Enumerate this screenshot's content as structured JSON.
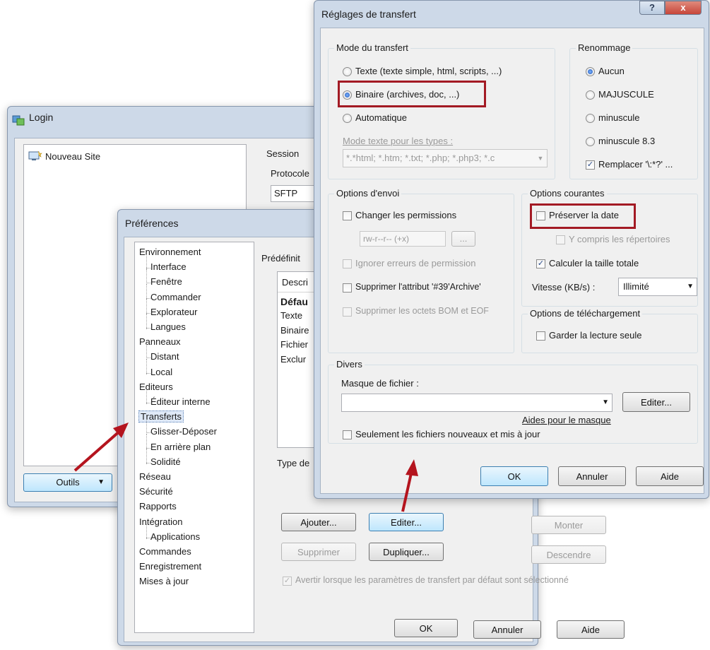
{
  "login": {
    "title": "Login",
    "site_item": "Nouveau Site",
    "session_label": "Session",
    "protocol_label": "Protocole",
    "protocol_value": "SFTP",
    "tools_button": "Outils"
  },
  "preferences": {
    "title": "Préférences",
    "tree": [
      {
        "label": "Environnement",
        "level": 0
      },
      {
        "label": "Interface",
        "level": 1
      },
      {
        "label": "Fenêtre",
        "level": 1
      },
      {
        "label": "Commander",
        "level": 1
      },
      {
        "label": "Explorateur",
        "level": 1
      },
      {
        "label": "Langues",
        "level": 1
      },
      {
        "label": "Panneaux",
        "level": 0
      },
      {
        "label": "Distant",
        "level": 1
      },
      {
        "label": "Local",
        "level": 1
      },
      {
        "label": "Editeurs",
        "level": 0
      },
      {
        "label": "Éditeur interne",
        "level": 1
      },
      {
        "label": "Transferts",
        "level": 0,
        "selected": true
      },
      {
        "label": "Glisser-Déposer",
        "level": 1
      },
      {
        "label": "En arrière plan",
        "level": 1
      },
      {
        "label": "Solidité",
        "level": 1
      },
      {
        "label": "Réseau",
        "level": 0
      },
      {
        "label": "Sécurité",
        "level": 0
      },
      {
        "label": "Rapports",
        "level": 0
      },
      {
        "label": "Intégration",
        "level": 0
      },
      {
        "label": "Applications",
        "level": 1
      },
      {
        "label": "Commandes",
        "level": 0
      },
      {
        "label": "Enregistrement",
        "level": 0
      },
      {
        "label": "Mises à jour",
        "level": 0
      }
    ],
    "presets_label": "Prédéfinit",
    "list_header": "Descri",
    "list_items": [
      "Défau",
      "Texte",
      "Binaire",
      "Fichier",
      "Exclur"
    ],
    "type_label": "Type de",
    "btn_add": "Ajouter...",
    "btn_edit": "Editer...",
    "btn_up": "Monter",
    "btn_delete": "Supprimer",
    "btn_duplicate": "Dupliquer...",
    "btn_down": "Descendre",
    "warn_checkbox": "Avertir lorsque les paramètres de transfert par défaut sont sélectionné",
    "btn_ok": "OK",
    "btn_cancel": "Annuler",
    "btn_help": "Aide"
  },
  "transfer": {
    "title": "Réglages de transfert",
    "help_glyph": "?",
    "close_glyph": "x",
    "mode_group": "Mode du transfert",
    "mode_text": "Texte (texte simple, html, scripts, ...)",
    "mode_binary": "Binaire (archives, doc, ...)",
    "mode_auto": "Automatique",
    "text_types_label": "Mode texte pour les types :",
    "text_types_value": "*.*html; *.htm; *.txt; *.php; *.php3; *.c",
    "rename_group": "Renommage",
    "rename_none": "Aucun",
    "rename_upper": "MAJUSCULE",
    "rename_lower": "minuscule",
    "rename_83": "minuscule 8.3",
    "rename_replace": "Remplacer '\\:*?' ...",
    "upload_group": "Options d'envoi",
    "change_perms": "Changer les permissions",
    "perms_value": "rw-r--r-- (+x)",
    "perms_btn": "...",
    "ignore_perm_errors": "Ignorer erreurs de permission",
    "remove_archive": "Supprimer l'attribut '#39'Archive'",
    "remove_bom": "Supprimer les octets BOM et EOF",
    "common_group": "Options courantes",
    "preserve_date": "Préserver la date",
    "include_dirs": "Y compris les répertoires",
    "calc_size": "Calculer la taille totale",
    "speed_label": "Vitesse (KB/s) :",
    "speed_value": "Illimité",
    "download_group": "Options de téléchargement",
    "keep_readonly": "Garder la lecture seule",
    "misc_group": "Divers",
    "file_mask_label": "Masque de fichier :",
    "file_mask_value": "",
    "edit_btn": "Editer...",
    "mask_help": "Aides pour le masque",
    "only_new": "Seulement les fichiers nouveaux et mis à jour",
    "btn_ok": "OK",
    "btn_cancel": "Annuler",
    "btn_help": "Aide"
  },
  "colors": {
    "highlight": "#a31a24",
    "selection": "#3399ff",
    "close_button": "#c7463a"
  }
}
